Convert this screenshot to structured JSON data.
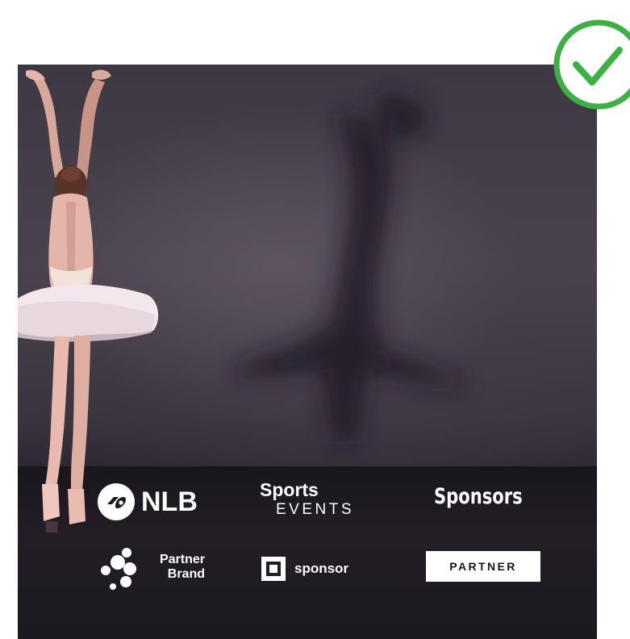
{
  "logos": {
    "nlb": {
      "text": "NLB",
      "icon": "nlb-mark-icon"
    },
    "sports_events": {
      "line1": "Sports",
      "line2": "EVENTS"
    },
    "sponsors": {
      "text": "Sponsors"
    },
    "partner_brand": {
      "line1": "Partner",
      "line2": "Brand",
      "icon": "partner-brand-dots-icon"
    },
    "sponsor": {
      "text": "sponsor",
      "icon": "sponsor-square-icon"
    },
    "partner": {
      "text": "PARTNER"
    }
  },
  "badge": {
    "icon": "check-circle-icon",
    "color": "#3cb043"
  },
  "colors": {
    "logo_text": "#ffffff",
    "partner_box": "#ffffff",
    "partner_box_text": "#1b181c"
  }
}
